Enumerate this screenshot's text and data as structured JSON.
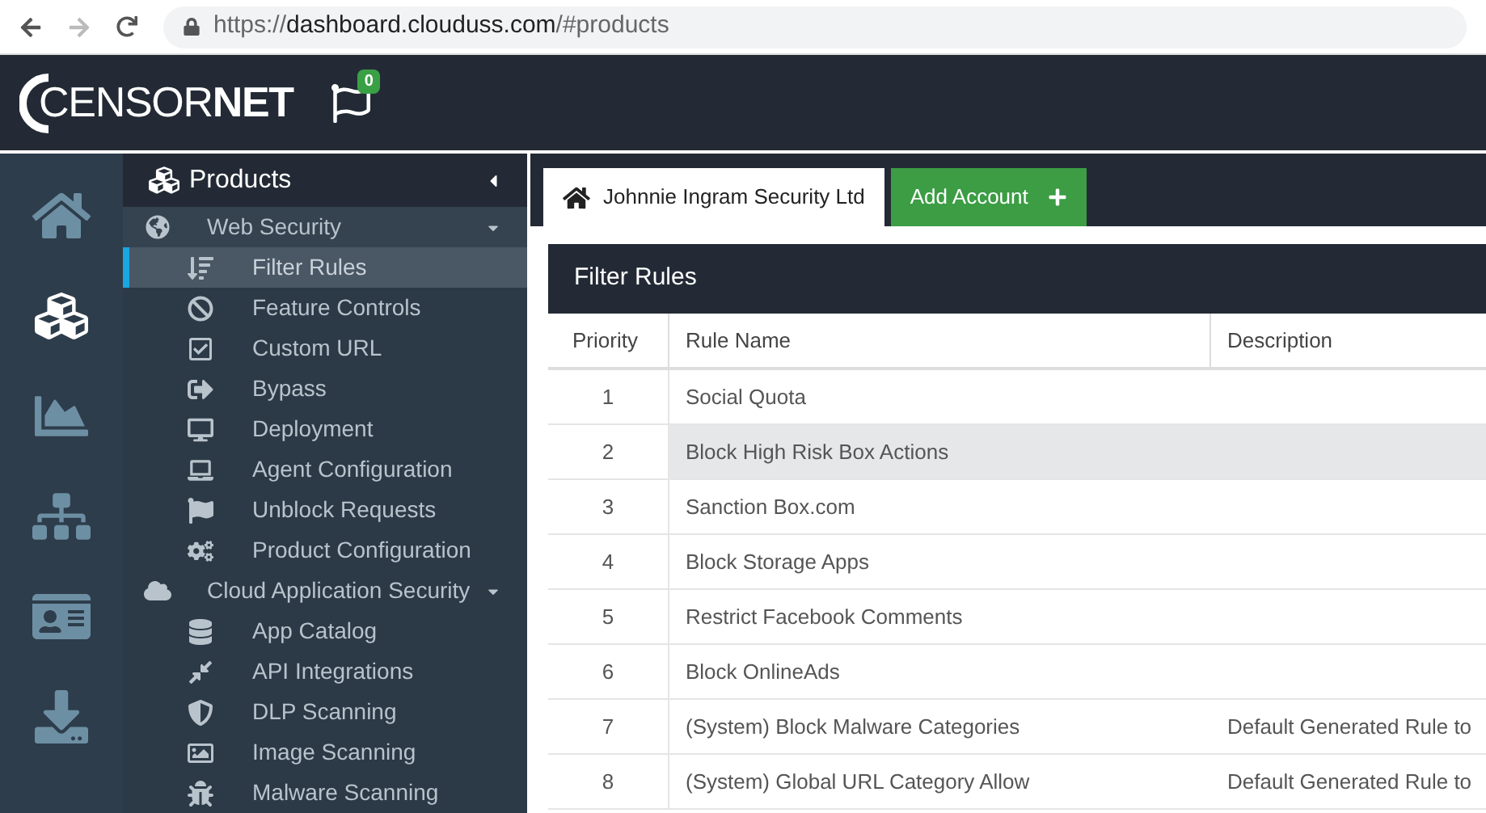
{
  "browser": {
    "url": {
      "scheme": "https://",
      "host": "dashboard.clouduss.com",
      "path": "/#products"
    }
  },
  "header": {
    "logo": "CENSOR**NET**",
    "flag_badge": "0"
  },
  "rail": [
    {
      "selected": false
    },
    {
      "selected": true
    },
    {
      "selected": false
    },
    {
      "selected": false
    },
    {
      "selected": false
    },
    {
      "selected": false
    }
  ],
  "sidebar": {
    "title": "Products",
    "groups": [
      {
        "label": "Web Security",
        "expanded": true,
        "children": [
          {
            "label": "Filter Rules",
            "selected": true
          },
          {
            "label": "Feature Controls",
            "selected": false
          },
          {
            "label": "Custom URL",
            "selected": false
          },
          {
            "label": "Bypass",
            "selected": false
          },
          {
            "label": "Deployment",
            "selected": false
          },
          {
            "label": "Agent Configuration",
            "selected": false
          },
          {
            "label": "Unblock Requests",
            "selected": false
          },
          {
            "label": "Product Configuration",
            "selected": false
          }
        ]
      },
      {
        "label": "Cloud Application Security",
        "expanded": true,
        "children": [
          {
            "label": "App Catalog",
            "selected": false
          },
          {
            "label": "API Integrations",
            "selected": false
          },
          {
            "label": "DLP Scanning",
            "selected": false
          },
          {
            "label": "Image Scanning",
            "selected": false
          },
          {
            "label": "Malware Scanning",
            "selected": false
          }
        ]
      }
    ]
  },
  "tabs": [
    {
      "kind": "account",
      "label": "Johnnie Ingram Security Ltd",
      "selected": true
    },
    {
      "kind": "add",
      "label": "Add Account"
    }
  ],
  "panel": {
    "title": "Filter Rules"
  },
  "table": {
    "columns": [
      "Priority",
      "Rule Name",
      "Description"
    ],
    "rows": [
      {
        "priority": "1",
        "name": "Social Quota",
        "selected": false
      },
      {
        "priority": "2",
        "name": "Block High Risk Box Actions",
        "selected": true
      },
      {
        "priority": "3",
        "name": "Sanction Box.com",
        "selected": false
      },
      {
        "priority": "4",
        "name": "Block Storage Apps",
        "selected": false
      },
      {
        "priority": "5",
        "name": "Restrict Facebook Comments",
        "selected": false
      },
      {
        "priority": "6",
        "name": "Block OnlineAds",
        "selected": false
      },
      {
        "priority": "7",
        "name": "(System) Block Malware Categories",
        "description": "Default Generated Rule to",
        "selected": false
      },
      {
        "priority": "8",
        "name": "(System) Global URL Category Allow",
        "description": "Default Generated Rule to",
        "selected": false
      }
    ]
  }
}
